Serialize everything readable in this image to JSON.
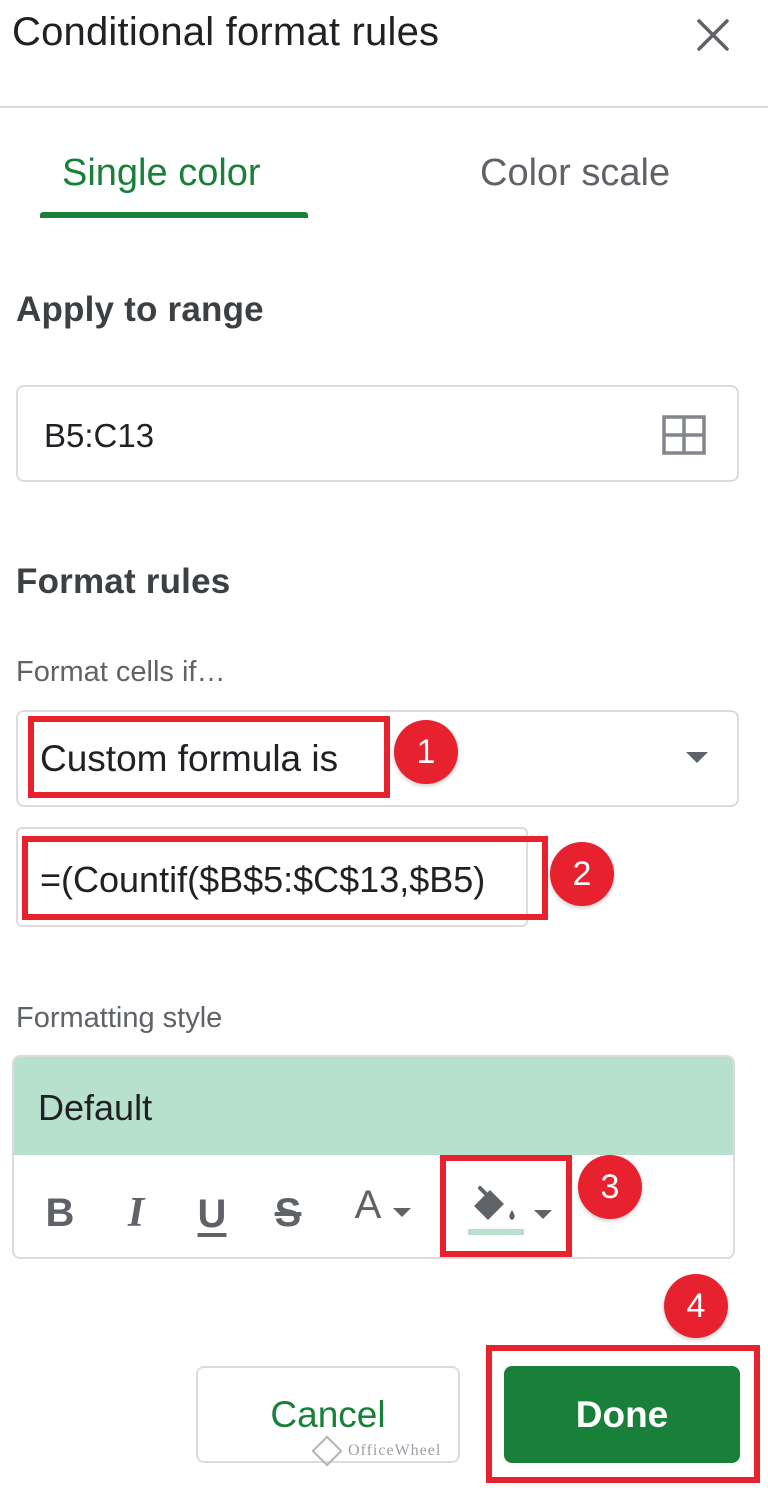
{
  "header": {
    "title": "Conditional format rules",
    "close_icon": "close-icon"
  },
  "tabs": [
    {
      "label": "Single color",
      "active": true
    },
    {
      "label": "Color scale",
      "active": false
    }
  ],
  "apply_to_range": {
    "heading": "Apply to range",
    "value": "B5:C13",
    "icon": "grid-select-icon"
  },
  "format_rules": {
    "heading": "Format rules",
    "condition_label": "Format cells if…",
    "condition_value": "Custom formula is",
    "formula_value": "=(Countif($B$5:$C$13,$B5)"
  },
  "formatting_style": {
    "label": "Formatting style",
    "preview_text": "Default",
    "preview_color": "#b7e1cd",
    "toolbar": {
      "bold": "B",
      "italic": "I",
      "underline": "U",
      "strikethrough": "S",
      "text_color": "A"
    }
  },
  "buttons": {
    "cancel": "Cancel",
    "done": "Done"
  },
  "annotations": {
    "step1": "1",
    "step2": "2",
    "step3": "3",
    "step4": "4",
    "highlight_color": "#e8212e"
  },
  "watermark": "OfficeWheel",
  "colors": {
    "accent": "#188038",
    "border": "#dadce0",
    "muted": "#5f6368"
  }
}
